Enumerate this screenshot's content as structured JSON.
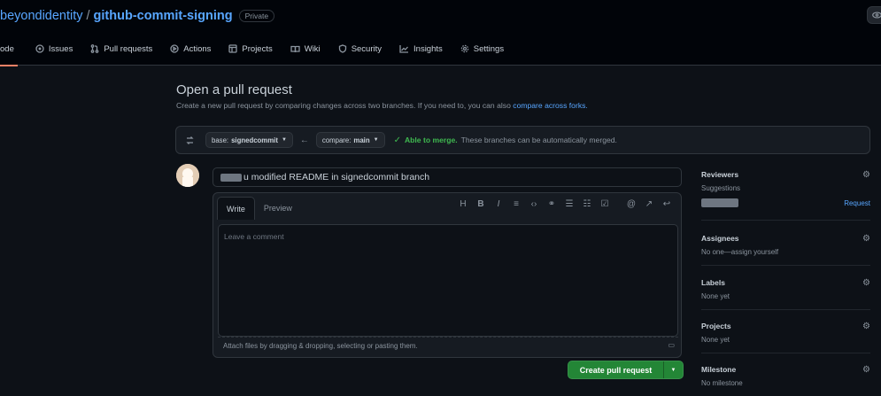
{
  "repo": {
    "owner": "beyondidentity",
    "slash": "/",
    "name": "github-commit-signing",
    "visibility": "Private"
  },
  "nav": [
    {
      "label": "ode",
      "icon": "code-icon"
    },
    {
      "label": "Issues",
      "icon": "issue-icon"
    },
    {
      "label": "Pull requests",
      "icon": "pull-request-icon"
    },
    {
      "label": "Actions",
      "icon": "play-icon"
    },
    {
      "label": "Projects",
      "icon": "table-icon"
    },
    {
      "label": "Wiki",
      "icon": "book-icon"
    },
    {
      "label": "Security",
      "icon": "shield-icon"
    },
    {
      "label": "Insights",
      "icon": "graph-icon"
    },
    {
      "label": "Settings",
      "icon": "gear-icon"
    }
  ],
  "page": {
    "title": "Open a pull request",
    "subtitle": "Create a new pull request by comparing changes across two branches. If you need to, you can also",
    "subtitle_link": "compare across forks."
  },
  "compare": {
    "base_prefix": "base:",
    "base_branch": "signedcommit",
    "compare_prefix": "compare:",
    "compare_branch": "main",
    "merge_ok": "Able to merge.",
    "merge_text": "These branches can be automatically merged."
  },
  "editor": {
    "title_value": "u modified  README in signedcommit branch",
    "tab_write": "Write",
    "tab_preview": "Preview",
    "placeholder": "Leave a comment",
    "attach_text": "Attach files by dragging & dropping, selecting or pasting them.",
    "toolbar": [
      "H",
      "B",
      "I",
      "quote-icon",
      "code-icon",
      "link-icon",
      "unordered-list-icon",
      "ordered-list-icon",
      "tasklist-icon",
      "mention-icon",
      "reference-icon",
      "reply-icon"
    ]
  },
  "actions": {
    "create_label": "Create pull request"
  },
  "sidebar": {
    "reviewers": {
      "title": "Reviewers",
      "sub": "Suggestions",
      "request": "Request"
    },
    "assignees": {
      "title": "Assignees",
      "sub": "No one—assign yourself"
    },
    "labels": {
      "title": "Labels",
      "sub": "None yet"
    },
    "projects": {
      "title": "Projects",
      "sub": "None yet"
    },
    "milestone": {
      "title": "Milestone",
      "sub": "No milestone"
    }
  },
  "colors": {
    "accent_blue": "#58a6ff",
    "success_green": "#238636",
    "merge_green": "#3fb950",
    "tab_underline": "#f78166"
  }
}
